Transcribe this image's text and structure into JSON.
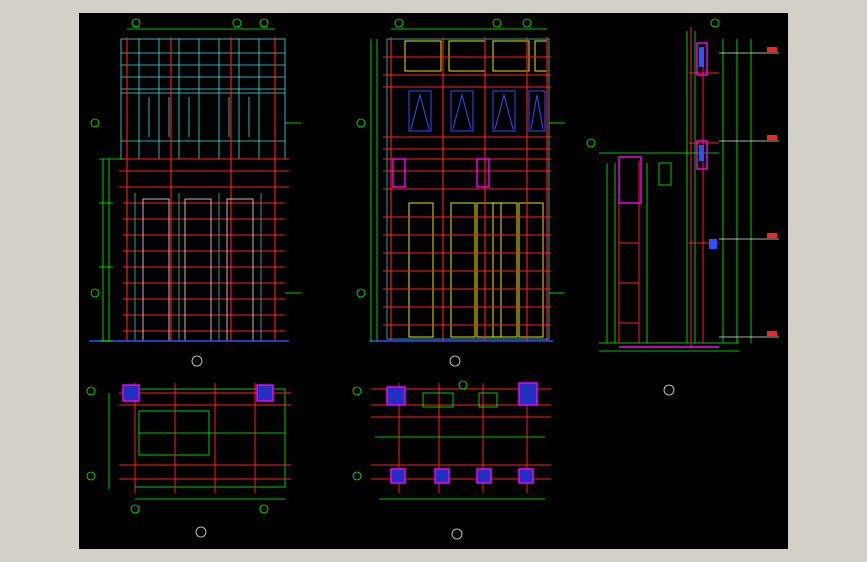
{
  "app": {
    "window_bg": "#d4d0c8",
    "canvas_bg": "#000000"
  },
  "palette": {
    "red": "#ff2020",
    "green": "#00ff00",
    "cyan": "#40e0e0",
    "yellow": "#ffff00",
    "magenta": "#ff00ff",
    "blue": "#3050ff",
    "white": "#e8e8e8"
  },
  "icons": [
    "axis-bubble-icon",
    "section-mark-icon",
    "level-marker-icon"
  ],
  "views": [
    {
      "id": "elevation-1",
      "label": ""
    },
    {
      "id": "elevation-2",
      "label": ""
    },
    {
      "id": "section-3",
      "label": ""
    },
    {
      "id": "plan-1",
      "label": ""
    },
    {
      "id": "plan-2",
      "label": ""
    }
  ]
}
